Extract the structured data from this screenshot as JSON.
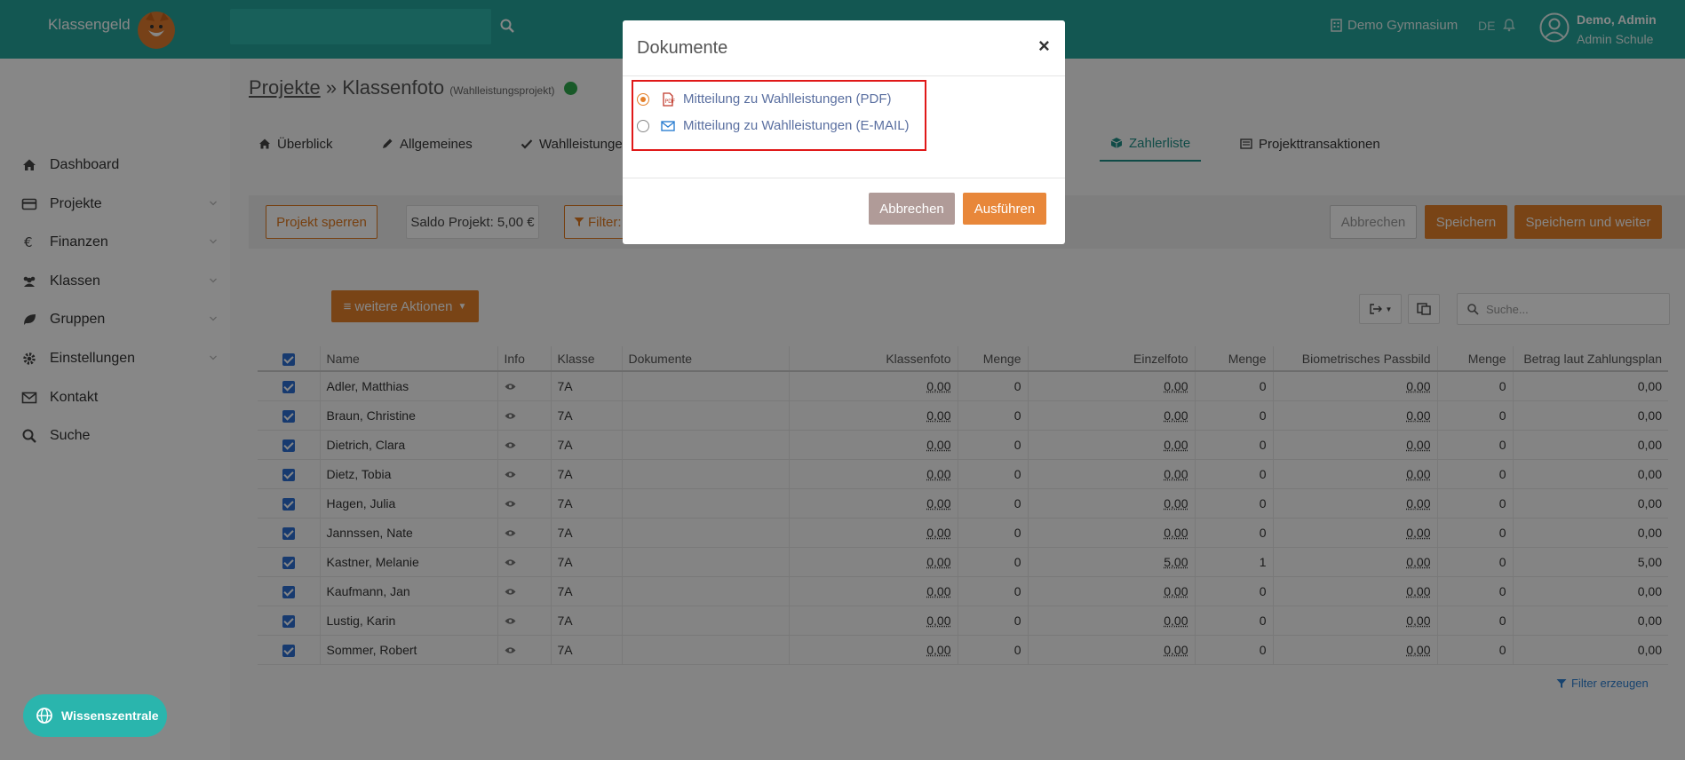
{
  "header": {
    "brand": "Klassengeld",
    "school": "Demo Gymnasium",
    "lang": "DE",
    "user_name": "Demo, Admin",
    "user_role": "Admin Schule"
  },
  "sidebar": {
    "items": [
      {
        "label": "Dashboard",
        "icon": "home-icon"
      },
      {
        "label": "Projekte",
        "icon": "credit-card-icon"
      },
      {
        "label": "Finanzen",
        "icon": "euro-icon"
      },
      {
        "label": "Klassen",
        "icon": "users-icon"
      },
      {
        "label": "Gruppen",
        "icon": "leaf-icon"
      },
      {
        "label": "Einstellungen",
        "icon": "gear-icon"
      },
      {
        "label": "Kontakt",
        "icon": "envelope-icon"
      },
      {
        "label": "Suche",
        "icon": "search-icon"
      }
    ],
    "knowledge_button": "Wissenszentrale"
  },
  "breadcrumb": {
    "root": "Projekte",
    "sep": " » ",
    "current": "Klassenfoto",
    "sub": "(Wahlleistungsprojekt)"
  },
  "tabs": [
    {
      "label": "Überblick"
    },
    {
      "label": "Allgemeines"
    },
    {
      "label": "Wahlleistunge"
    },
    {
      "label": "Zahlerliste"
    },
    {
      "label": "Projekttransaktionen"
    }
  ],
  "toolbar": {
    "lock": "Projekt sperren",
    "saldo": "Saldo Projekt: 5,00 €",
    "filter": "Filter:",
    "cancel": "Abbrechen",
    "save": "Speichern",
    "save_next": "Speichern und weiter"
  },
  "actions": {
    "more": "weitere Aktionen",
    "search_placeholder": "Suche..."
  },
  "table": {
    "columns": [
      "Name",
      "Info",
      "Klasse",
      "Dokumente",
      "Klassenfoto",
      "Menge",
      "Einzelfoto",
      "Menge",
      "Biometrisches Passbild",
      "Menge",
      "Betrag laut Zahlungsplan"
    ],
    "rows": [
      {
        "name": "Adler, Matthias",
        "klasse": "7A",
        "klassenfoto": "0,00",
        "m1": "0",
        "einzelfoto": "0,00",
        "m2": "0",
        "passbild": "0,00",
        "m3": "0",
        "betrag": "0,00"
      },
      {
        "name": "Braun, Christine",
        "klasse": "7A",
        "klassenfoto": "0,00",
        "m1": "0",
        "einzelfoto": "0,00",
        "m2": "0",
        "passbild": "0,00",
        "m3": "0",
        "betrag": "0,00"
      },
      {
        "name": "Dietrich, Clara",
        "klasse": "7A",
        "klassenfoto": "0,00",
        "m1": "0",
        "einzelfoto": "0,00",
        "m2": "0",
        "passbild": "0,00",
        "m3": "0",
        "betrag": "0,00"
      },
      {
        "name": "Dietz, Tobia",
        "klasse": "7A",
        "klassenfoto": "0,00",
        "m1": "0",
        "einzelfoto": "0,00",
        "m2": "0",
        "passbild": "0,00",
        "m3": "0",
        "betrag": "0,00"
      },
      {
        "name": "Hagen, Julia",
        "klasse": "7A",
        "klassenfoto": "0,00",
        "m1": "0",
        "einzelfoto": "0,00",
        "m2": "0",
        "passbild": "0,00",
        "m3": "0",
        "betrag": "0,00"
      },
      {
        "name": "Jannssen, Nate",
        "klasse": "7A",
        "klassenfoto": "0,00",
        "m1": "0",
        "einzelfoto": "0,00",
        "m2": "0",
        "passbild": "0,00",
        "m3": "0",
        "betrag": "0,00"
      },
      {
        "name": "Kastner, Melanie",
        "klasse": "7A",
        "klassenfoto": "0,00",
        "m1": "0",
        "einzelfoto": "5,00",
        "m2": "1",
        "passbild": "0,00",
        "m3": "0",
        "betrag": "5,00"
      },
      {
        "name": "Kaufmann, Jan",
        "klasse": "7A",
        "klassenfoto": "0,00",
        "m1": "0",
        "einzelfoto": "0,00",
        "m2": "0",
        "passbild": "0,00",
        "m3": "0",
        "betrag": "0,00"
      },
      {
        "name": "Lustig, Karin",
        "klasse": "7A",
        "klassenfoto": "0,00",
        "m1": "0",
        "einzelfoto": "0,00",
        "m2": "0",
        "passbild": "0,00",
        "m3": "0",
        "betrag": "0,00"
      },
      {
        "name": "Sommer, Robert",
        "klasse": "7A",
        "klassenfoto": "0,00",
        "m1": "0",
        "einzelfoto": "0,00",
        "m2": "0",
        "passbild": "0,00",
        "m3": "0",
        "betrag": "0,00"
      }
    ],
    "filter_link": "Filter erzeugen"
  },
  "modal": {
    "title": "Dokumente",
    "close": "×",
    "options": [
      {
        "label": "Mitteilung zu Wahlleistungen (PDF)",
        "selected": true,
        "icon": "pdf-file-icon"
      },
      {
        "label": "Mitteilung zu Wahlleistungen (E-MAIL)",
        "selected": false,
        "icon": "envelope-icon"
      }
    ],
    "cancel": "Abbrechen",
    "run": "Ausführen"
  },
  "colors": {
    "brand_teal": "#24a59b",
    "accent_orange": "#e4802a",
    "highlight_red": "#e01818"
  }
}
